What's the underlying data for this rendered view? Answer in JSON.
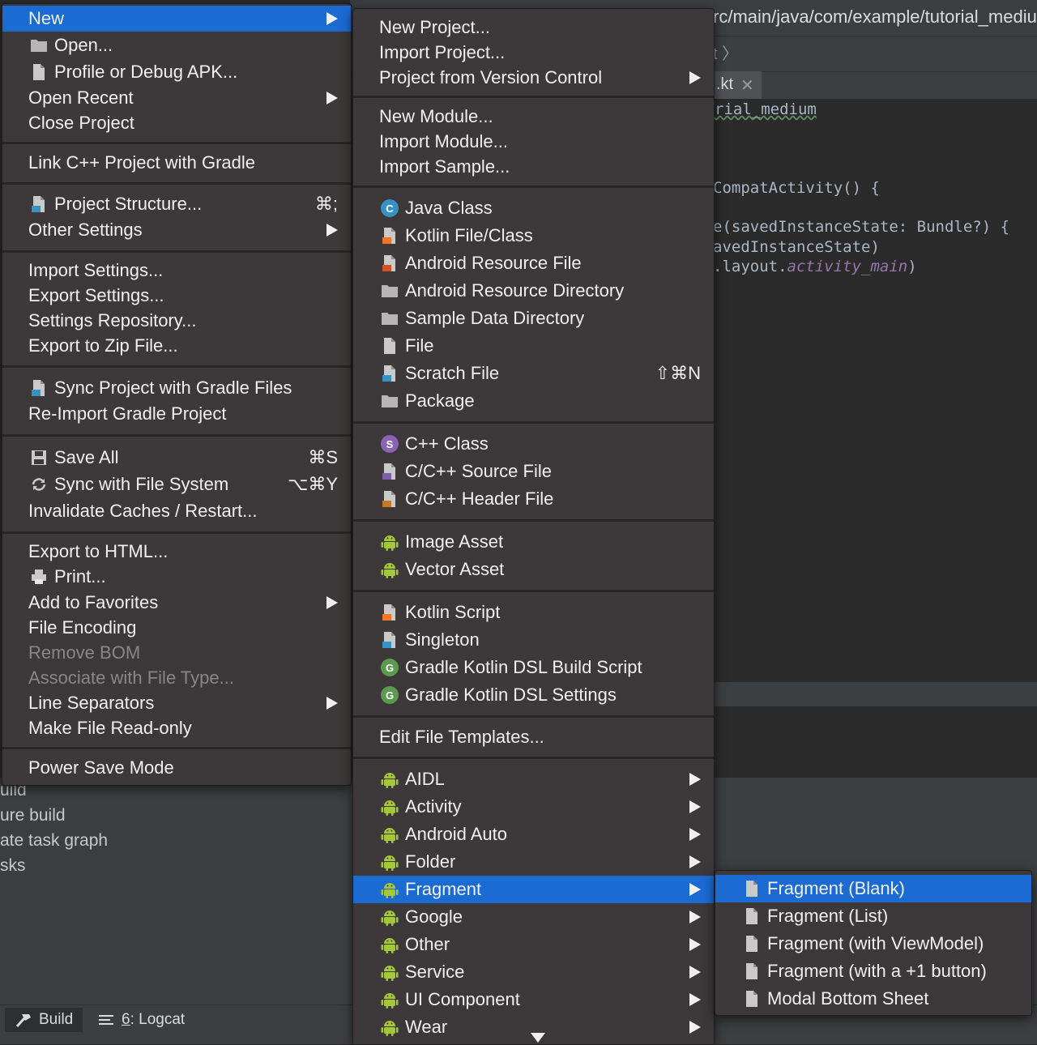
{
  "ide": {
    "path": "rc/main/java/com/example/tutorial_mediu",
    "breadcrumb": "t 〉",
    "tab_label": ".kt",
    "tab_close": "✕",
    "code_lines": [
      "rial_medium",
      "CompatActivity() {",
      "e(savedInstanceState: Bundle?) {",
      "avedInstanceState)",
      ".layout.",
      "activity_main",
      ")"
    ],
    "bg_lines": [
      "uild",
      "ure build",
      "ate task graph",
      "sks"
    ],
    "status_build": "Build",
    "status_logcat_num": "6",
    "status_logcat": ": Logcat"
  },
  "file_menu": {
    "items": [
      {
        "label": "New",
        "submenu": true,
        "selected": true
      },
      {
        "label": "Open...",
        "icon": "folder-icon"
      },
      {
        "label": "Profile or Debug APK...",
        "icon": "apk-icon"
      },
      {
        "label": "Open Recent",
        "submenu": true
      },
      {
        "label": "Close Project"
      },
      {
        "label": "Link C++ Project with Gradle"
      },
      {
        "label": "Project Structure...",
        "icon": "project-structure-icon",
        "shortcut": "⌘;"
      },
      {
        "label": "Other Settings",
        "submenu": true
      },
      {
        "label": "Import Settings..."
      },
      {
        "label": "Export Settings..."
      },
      {
        "label": "Settings Repository..."
      },
      {
        "label": "Export to Zip File..."
      },
      {
        "label": "Sync Project with Gradle Files",
        "icon": "gradle-sync-icon"
      },
      {
        "label": "Re-Import Gradle Project"
      },
      {
        "label": "Save All",
        "icon": "save-icon",
        "shortcut": "⌘S"
      },
      {
        "label": "Sync with File System",
        "icon": "refresh-icon",
        "shortcut": "⌥⌘Y"
      },
      {
        "label": "Invalidate Caches / Restart..."
      },
      {
        "label": "Export to HTML..."
      },
      {
        "label": "Print...",
        "icon": "print-icon"
      },
      {
        "label": "Add to Favorites",
        "submenu": true
      },
      {
        "label": "File Encoding"
      },
      {
        "label": "Remove BOM",
        "disabled": true
      },
      {
        "label": "Associate with File Type...",
        "disabled": true
      },
      {
        "label": "Line Separators",
        "submenu": true
      },
      {
        "label": "Make File Read-only"
      },
      {
        "label": "Power Save Mode"
      }
    ]
  },
  "new_menu": {
    "items": [
      {
        "label": "New Project..."
      },
      {
        "label": "Import Project..."
      },
      {
        "label": "Project from Version Control",
        "submenu": true
      },
      {
        "label": "New Module..."
      },
      {
        "label": "Import Module..."
      },
      {
        "label": "Import Sample..."
      },
      {
        "label": "Java Class",
        "icon": "java-class-icon",
        "glyph": "C"
      },
      {
        "label": "Kotlin File/Class",
        "icon": "kotlin-file-icon"
      },
      {
        "label": "Android Resource File",
        "icon": "android-resource-file-icon"
      },
      {
        "label": "Android Resource Directory",
        "icon": "folder-icon"
      },
      {
        "label": "Sample Data Directory",
        "icon": "folder-icon"
      },
      {
        "label": "File",
        "icon": "file-icon"
      },
      {
        "label": "Scratch File",
        "icon": "scratch-file-icon",
        "shortcut": "⇧⌘N"
      },
      {
        "label": "Package",
        "icon": "package-icon"
      },
      {
        "label": "C++ Class",
        "icon": "cpp-class-icon",
        "glyph": "S"
      },
      {
        "label": "C/C++ Source File",
        "icon": "cpp-source-icon"
      },
      {
        "label": "C/C++ Header File",
        "icon": "cpp-header-icon"
      },
      {
        "label": "Image Asset",
        "icon": "android-icon"
      },
      {
        "label": "Vector Asset",
        "icon": "android-icon"
      },
      {
        "label": "Kotlin Script",
        "icon": "kotlin-script-icon"
      },
      {
        "label": "Singleton",
        "icon": "singleton-icon"
      },
      {
        "label": "Gradle Kotlin DSL Build Script",
        "icon": "gradle-icon",
        "glyph": "G"
      },
      {
        "label": "Gradle Kotlin DSL Settings",
        "icon": "gradle-icon",
        "glyph": "G"
      },
      {
        "label": "Edit File Templates..."
      },
      {
        "label": "AIDL",
        "icon": "android-icon",
        "submenu": true
      },
      {
        "label": "Activity",
        "icon": "android-icon",
        "submenu": true
      },
      {
        "label": "Android Auto",
        "icon": "android-icon",
        "submenu": true
      },
      {
        "label": "Folder",
        "icon": "android-icon",
        "submenu": true
      },
      {
        "label": "Fragment",
        "icon": "android-icon",
        "submenu": true,
        "selected": true
      },
      {
        "label": "Google",
        "icon": "android-icon",
        "submenu": true
      },
      {
        "label": "Other",
        "icon": "android-icon",
        "submenu": true
      },
      {
        "label": "Service",
        "icon": "android-icon",
        "submenu": true
      },
      {
        "label": "UI Component",
        "icon": "android-icon",
        "submenu": true
      },
      {
        "label": "Wear",
        "icon": "android-icon",
        "submenu": true
      }
    ]
  },
  "fragment_menu": {
    "items": [
      {
        "label": "Fragment (Blank)",
        "selected": true
      },
      {
        "label": "Fragment (List)"
      },
      {
        "label": "Fragment (with ViewModel)"
      },
      {
        "label": "Fragment (with a +1 button)"
      },
      {
        "label": "Modal Bottom Sheet"
      }
    ]
  },
  "colors": {
    "selection": "#1b6bd3",
    "menu_bg": "#3d3839",
    "android_green": "#a4c639"
  }
}
